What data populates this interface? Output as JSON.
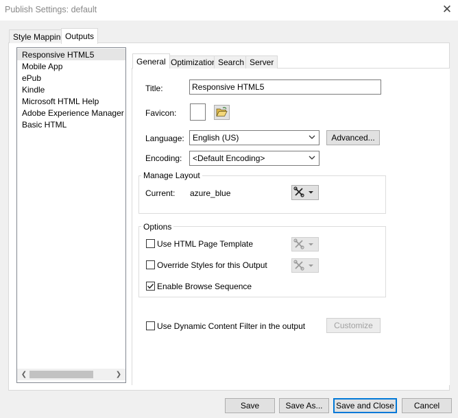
{
  "window": {
    "title": "Publish Settings: default"
  },
  "outer_tabs": [
    {
      "label": "Style Mapping"
    },
    {
      "label": "Outputs"
    }
  ],
  "outputs_list": [
    {
      "label": "Responsive HTML5",
      "selected": true
    },
    {
      "label": "Mobile App"
    },
    {
      "label": "ePub"
    },
    {
      "label": "Kindle"
    },
    {
      "label": "Microsoft HTML Help"
    },
    {
      "label": "Adobe Experience Manager Mo"
    },
    {
      "label": "Basic HTML"
    }
  ],
  "inner_tabs": [
    {
      "label": "General"
    },
    {
      "label": "Optimization"
    },
    {
      "label": "Search"
    },
    {
      "label": "Server"
    }
  ],
  "general": {
    "title_label": "Title:",
    "title_value": "Responsive HTML5",
    "favicon_label": "Favicon:",
    "language_label": "Language:",
    "language_value": "English (US)",
    "advanced_button": "Advanced...",
    "encoding_label": "Encoding:",
    "encoding_value": "<Default Encoding>"
  },
  "manage_layout": {
    "title": "Manage Layout",
    "current_label": "Current:",
    "current_value": "azure_blue"
  },
  "options": {
    "title": "Options",
    "use_html_template": {
      "label": "Use HTML Page Template",
      "checked": false
    },
    "override_styles": {
      "label": "Override Styles for this Output",
      "checked": false
    },
    "enable_browse": {
      "label": "Enable Browse Sequence",
      "checked": true
    }
  },
  "dynamic_filter": {
    "label": "Use Dynamic Content Filter in the output",
    "checked": false
  },
  "customize_button": "Customize",
  "footer": {
    "save": "Save",
    "save_as": "Save As...",
    "save_and_close": "Save and Close",
    "cancel": "Cancel"
  },
  "colors": {
    "focus_border": "#0078d7",
    "selection": "#e5e5e5"
  },
  "icons": [
    "close-icon",
    "folder-open-icon",
    "tools-icon",
    "chevron-down-icon",
    "check-icon",
    "scroll-left-icon",
    "scroll-right-icon"
  ]
}
